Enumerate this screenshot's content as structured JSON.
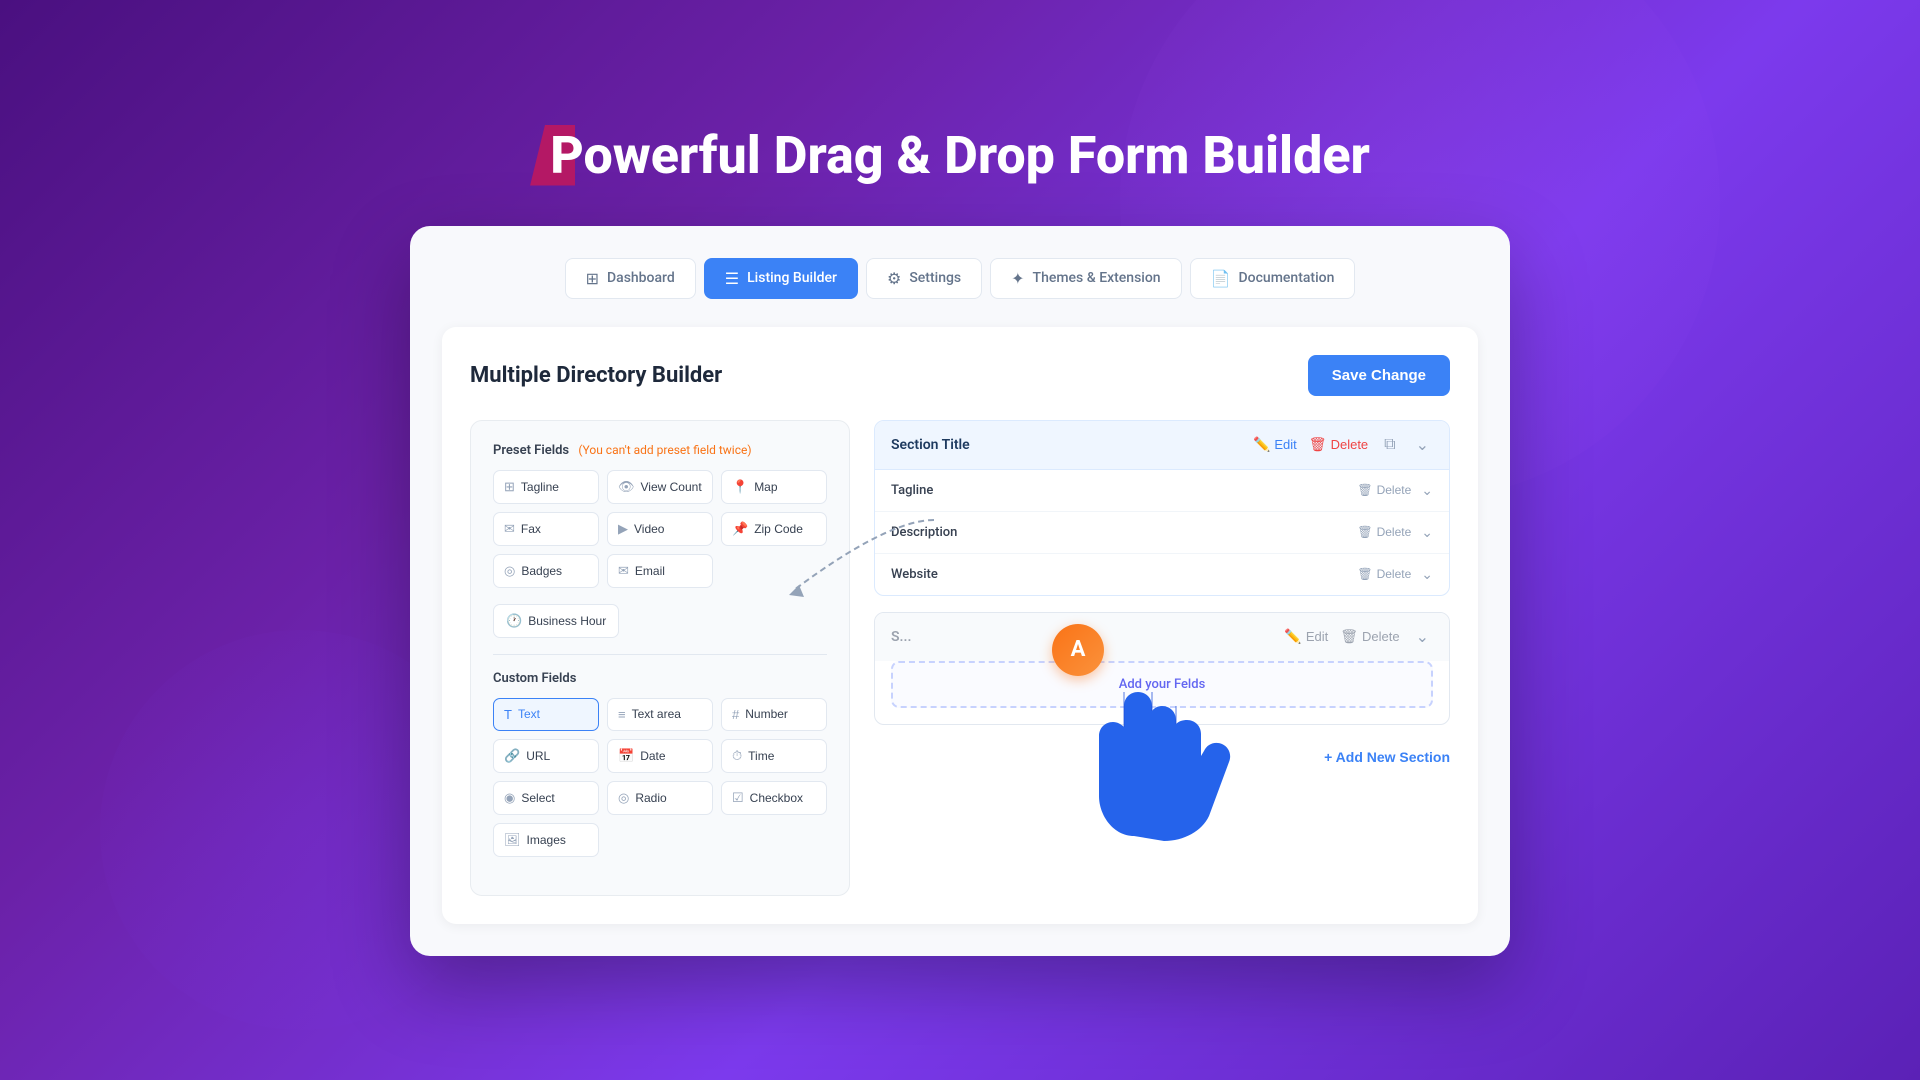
{
  "hero": {
    "title": "Powerful Drag & Drop Form Builder"
  },
  "nav": {
    "tabs": [
      {
        "id": "dashboard",
        "label": "Dashboard",
        "icon": "⊞",
        "active": false
      },
      {
        "id": "listing-builder",
        "label": "Listing Builder",
        "icon": "☰",
        "active": true
      },
      {
        "id": "settings",
        "label": "Settings",
        "icon": "⚙",
        "active": false
      },
      {
        "id": "themes-extension",
        "label": "Themes & Extension",
        "icon": "✦",
        "active": false
      },
      {
        "id": "documentation",
        "label": "Documentation",
        "icon": "📄",
        "active": false
      }
    ]
  },
  "builder": {
    "title": "Multiple Directory Builder",
    "save_btn": "Save Change",
    "preset_fields_label": "Preset Fields",
    "preset_fields_note": "(You can't add preset field twice)",
    "preset_fields": [
      {
        "id": "tagline",
        "label": "Tagline",
        "icon": "⊞"
      },
      {
        "id": "view-count",
        "label": "View Count",
        "icon": "👁"
      },
      {
        "id": "map",
        "label": "Map",
        "icon": "📍"
      },
      {
        "id": "fax",
        "label": "Fax",
        "icon": "✉"
      },
      {
        "id": "video",
        "label": "Video",
        "icon": "▶"
      },
      {
        "id": "zip-code",
        "label": "Zip Code",
        "icon": "📌"
      },
      {
        "id": "badges",
        "label": "Badges",
        "icon": "◎"
      },
      {
        "id": "email",
        "label": "Email",
        "icon": "✉"
      },
      {
        "id": "business-hour",
        "label": "Business Hour",
        "icon": "🕐"
      }
    ],
    "custom_fields_label": "Custom Fields",
    "custom_fields": [
      {
        "id": "text",
        "label": "Text",
        "icon": "T",
        "active": true
      },
      {
        "id": "text-area",
        "label": "Text area",
        "icon": "≡"
      },
      {
        "id": "number",
        "label": "Number",
        "icon": "#"
      },
      {
        "id": "url",
        "label": "URL",
        "icon": "🔗"
      },
      {
        "id": "date",
        "label": "Date",
        "icon": "📅"
      },
      {
        "id": "time",
        "label": "Time",
        "icon": "⏱"
      },
      {
        "id": "select",
        "label": "Select",
        "icon": "◉"
      },
      {
        "id": "radio",
        "label": "Radio",
        "icon": "◎"
      },
      {
        "id": "checkbox",
        "label": "Checkbox",
        "icon": "☑"
      },
      {
        "id": "images",
        "label": "Images",
        "icon": "🖼"
      }
    ],
    "sections": [
      {
        "id": "section-1",
        "title": "Section Title",
        "fields": [
          {
            "id": "tagline-field",
            "label": "Tagline"
          },
          {
            "id": "description-field",
            "label": "Description"
          },
          {
            "id": "website-field",
            "label": "Website"
          }
        ]
      },
      {
        "id": "section-2",
        "title": "S...",
        "fields": []
      }
    ],
    "section_actions": {
      "edit": "Edit",
      "delete": "Delete",
      "field_delete": "Delete",
      "add_fields": "Add your Felds",
      "add_section": "+ Add New Section"
    },
    "avatar": "A"
  }
}
